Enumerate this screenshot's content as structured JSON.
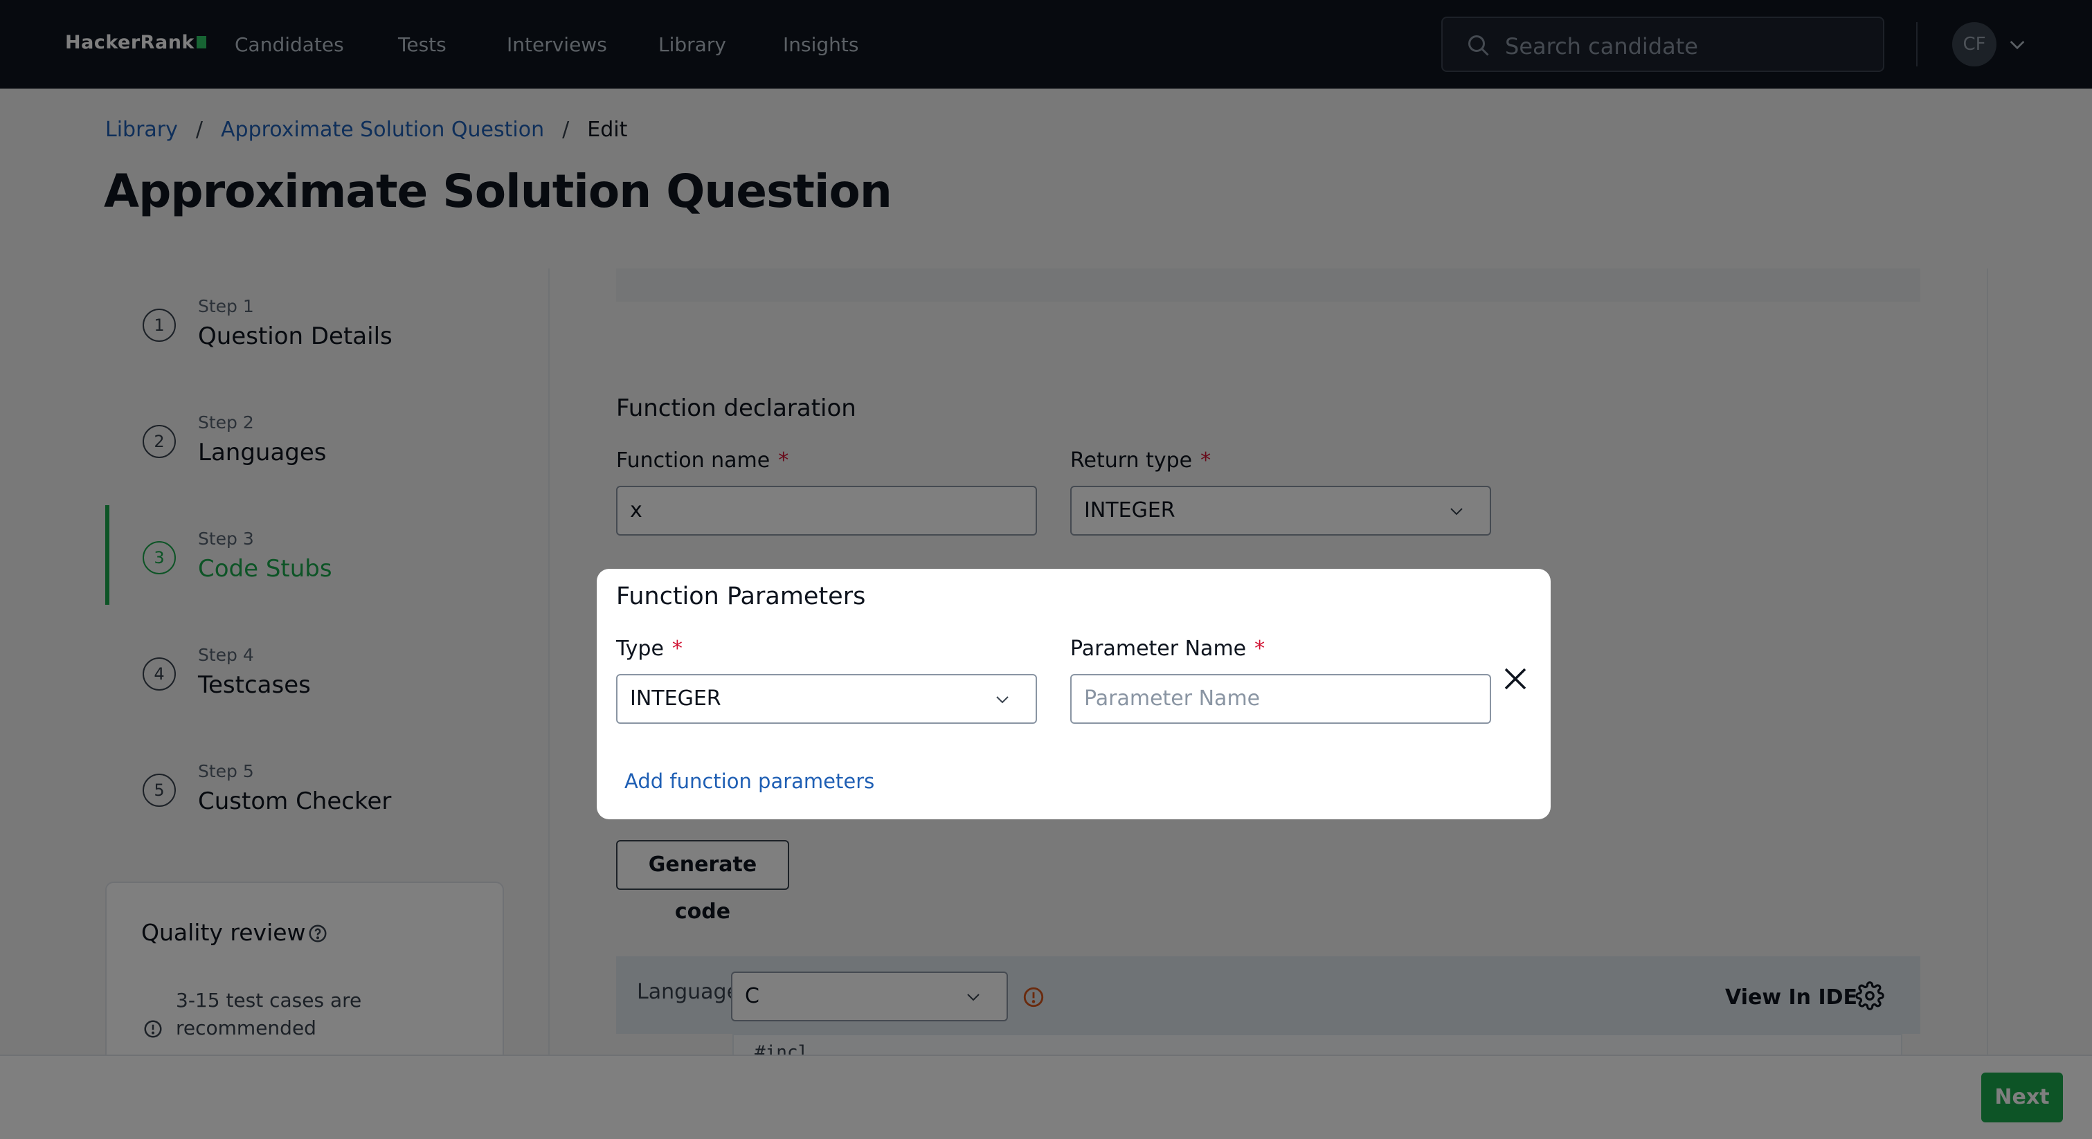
{
  "nav": {
    "logo": "HackerRank",
    "items": [
      "Candidates",
      "Tests",
      "Interviews",
      "Library",
      "Insights"
    ],
    "search_placeholder": "Search candidate",
    "avatar_initials": "CF"
  },
  "breadcrumb": {
    "library": "Library",
    "question": "Approximate Solution Question",
    "current": "Edit",
    "separator": "/"
  },
  "page_title": "Approximate Solution Question",
  "steps": [
    {
      "sub": "Step 1",
      "name": "Question Details",
      "num": "1"
    },
    {
      "sub": "Step 2",
      "name": "Languages",
      "num": "2"
    },
    {
      "sub": "Step 3",
      "name": "Code Stubs",
      "num": "3"
    },
    {
      "sub": "Step 4",
      "name": "Testcases",
      "num": "4"
    },
    {
      "sub": "Step 5",
      "name": "Custom Checker",
      "num": "5"
    }
  ],
  "quality": {
    "title": "Quality review",
    "note": "3-15 test cases are recommended"
  },
  "function_declaration": {
    "title": "Function declaration",
    "name_label": "Function name",
    "name_value": "x",
    "return_label": "Return type",
    "return_value": "INTEGER",
    "required_mark": "*"
  },
  "generate_button": "Generate code",
  "editor": {
    "language_label": "Language",
    "language_value": "C",
    "view_ide": "View In IDE",
    "first_line": "#incl"
  },
  "modal": {
    "title": "Function Parameters",
    "type_label": "Type",
    "type_value": "INTEGER",
    "param_label": "Parameter Name",
    "param_placeholder": "Parameter Name",
    "add_link": "Add function parameters",
    "required_mark": "*"
  },
  "next_button": "Next",
  "colors": {
    "nav_bg": "#0e141e",
    "accent_green": "#1ba94c",
    "link_blue": "#1f5fb4",
    "required_red": "#d11534"
  }
}
